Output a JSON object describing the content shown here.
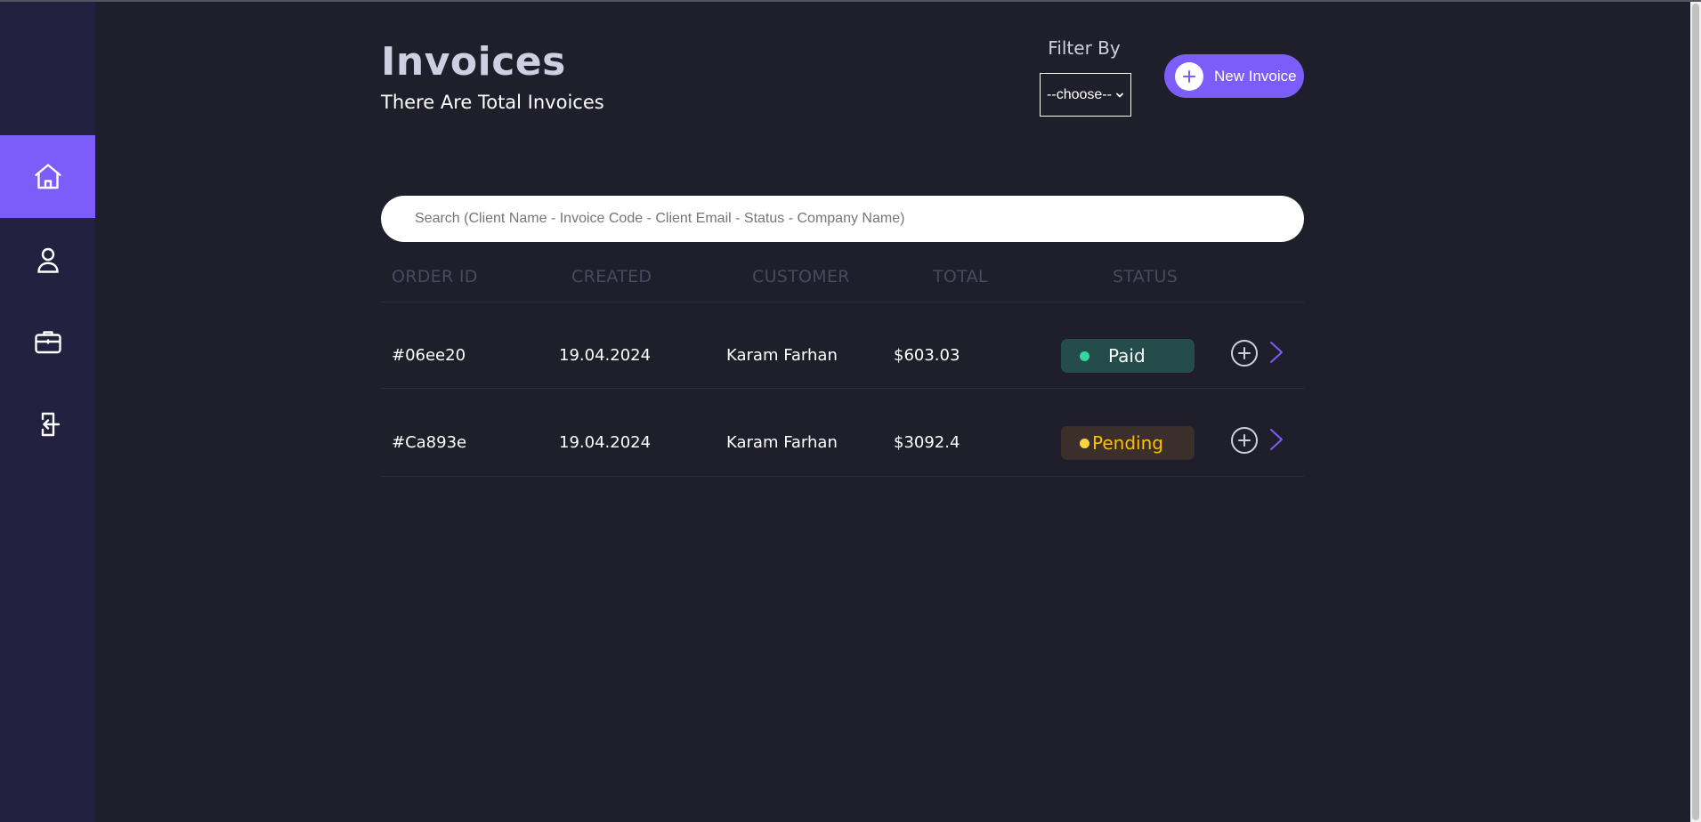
{
  "header": {
    "title": "Invoices",
    "subtitle": "There Are Total Invoices"
  },
  "filter": {
    "label": "Filter By",
    "selected": "--choose--"
  },
  "new_invoice": {
    "label": "New Invoice"
  },
  "search": {
    "placeholder": "Search (Client Name - Invoice Code - Client Email - Status - Company Name)",
    "value": ""
  },
  "table": {
    "columns": [
      "ORDER ID",
      "CREATED",
      "CUSTOMER",
      "TOTAL",
      "STATUS"
    ],
    "rows": [
      {
        "order_id": "#06ee20",
        "created": "19.04.2024",
        "customer": "Karam Farhan",
        "total": "$603.03",
        "status": "Paid"
      },
      {
        "order_id": "#Ca893e",
        "created": "19.04.2024",
        "customer": "Karam Farhan",
        "total": "$3092.4",
        "status": "Pending"
      }
    ]
  },
  "sidebar": {
    "items": [
      {
        "icon": "home-icon",
        "active": true
      },
      {
        "icon": "user-icon",
        "active": false
      },
      {
        "icon": "briefcase-icon",
        "active": false
      },
      {
        "icon": "logout-icon",
        "active": false
      }
    ]
  },
  "colors": {
    "background": "#1f1e2b",
    "sidebar": "#222140",
    "accent": "#7c5df9",
    "paid": "#33d69f",
    "pending": "#ffbf00"
  }
}
